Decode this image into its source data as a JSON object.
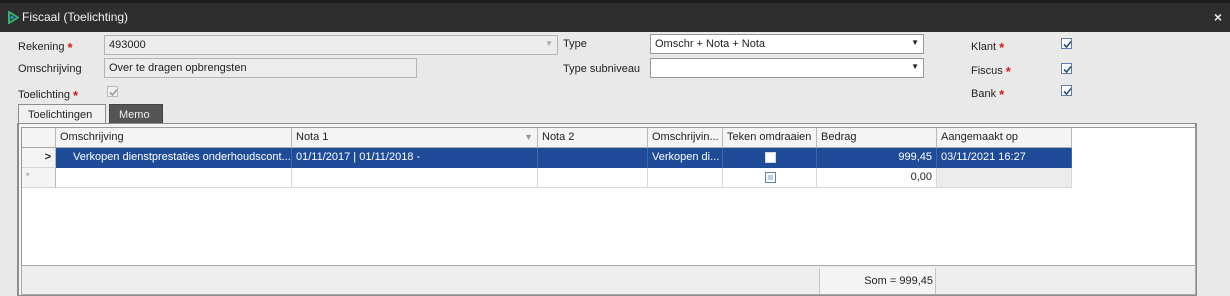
{
  "window": {
    "title": "Fiscaal (Toelichting)",
    "close_glyph": "×"
  },
  "form": {
    "rekening": {
      "label": "Rekening",
      "value": "493000"
    },
    "omschrijving": {
      "label": "Omschrijving",
      "value": "Over te dragen opbrengsten"
    },
    "toelichting": {
      "label": "Toelichting",
      "checked": true
    },
    "type": {
      "label": "Type",
      "value": "Omschr + Nota + Nota"
    },
    "type_subniveau": {
      "label": "Type subniveau",
      "value": ""
    },
    "klant": {
      "label": "Klant",
      "checked": true
    },
    "fiscus": {
      "label": "Fiscus",
      "checked": true
    },
    "bank": {
      "label": "Bank",
      "checked": true
    },
    "required_mark": "*"
  },
  "tabs": [
    {
      "label": "Toelichtingen",
      "active": true
    },
    {
      "label": "Memo",
      "active": false
    }
  ],
  "grid": {
    "columns": [
      "Omschrijving",
      "Nota 1",
      "Nota 2",
      "Omschrijvin...",
      "Teken omdraaien",
      "Bedrag",
      "Aangemaakt op"
    ],
    "rows": [
      {
        "indicator": ">",
        "omschrijving": "Verkopen dienstprestaties onderhoudscont...",
        "nota1": "01/11/2017 | 01/11/2018 -",
        "nota2": "",
        "omschrijving2": "Verkopen di...",
        "teken_omdraaien": false,
        "bedrag": "999,45",
        "aangemaakt_op": "03/11/2021 16:27"
      }
    ],
    "new_row": {
      "indicator": "*",
      "bedrag": "0,00"
    },
    "summary": "Som = 999,45"
  },
  "colors": {
    "titlebar": "#2e2e2e",
    "selection": "#1f4c99",
    "required": "#d01818"
  }
}
